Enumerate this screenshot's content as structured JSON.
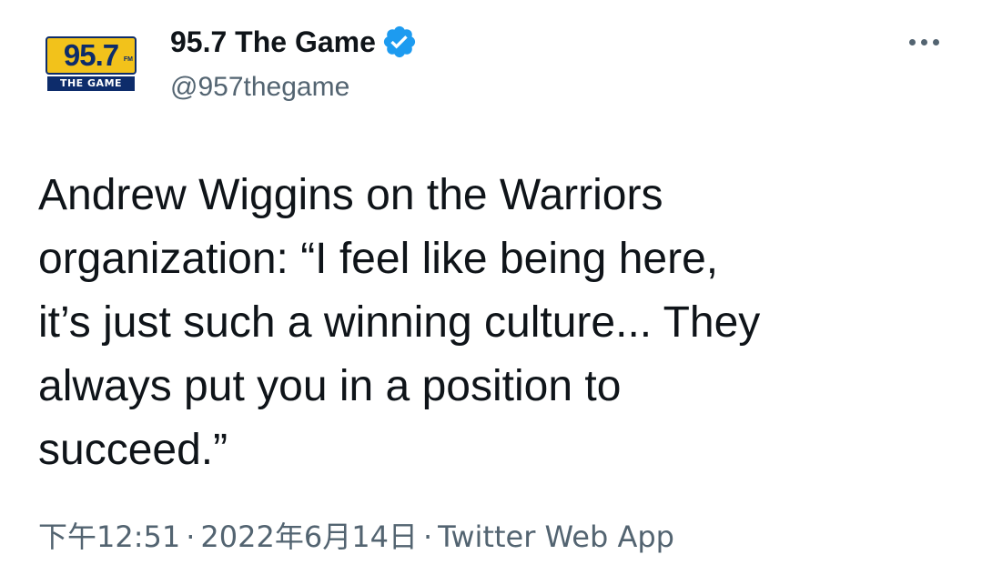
{
  "author": {
    "display_name": "95.7 The Game",
    "handle": "@957thegame",
    "verified": true,
    "logo": {
      "number": "95.7",
      "band": "FM",
      "subtitle": "THE GAME"
    }
  },
  "tweet": {
    "text": "Andrew Wiggins on the Warriors\norganization: “I feel like being here,\nit’s just such a winning culture... They\nalways put you in a position to\nsucceed.”"
  },
  "meta": {
    "time": "下午12:51",
    "separator": "·",
    "date": "2022年6月14日",
    "source": "Twitter Web App"
  },
  "icons": {
    "verified": "verified-badge-icon",
    "more": "more-options-icon"
  },
  "colors": {
    "text_primary": "#0f1419",
    "text_secondary": "#536471",
    "verified_blue": "#1d9bf0",
    "logo_yellow": "#f2c21b",
    "logo_navy": "#0d2c6b"
  }
}
